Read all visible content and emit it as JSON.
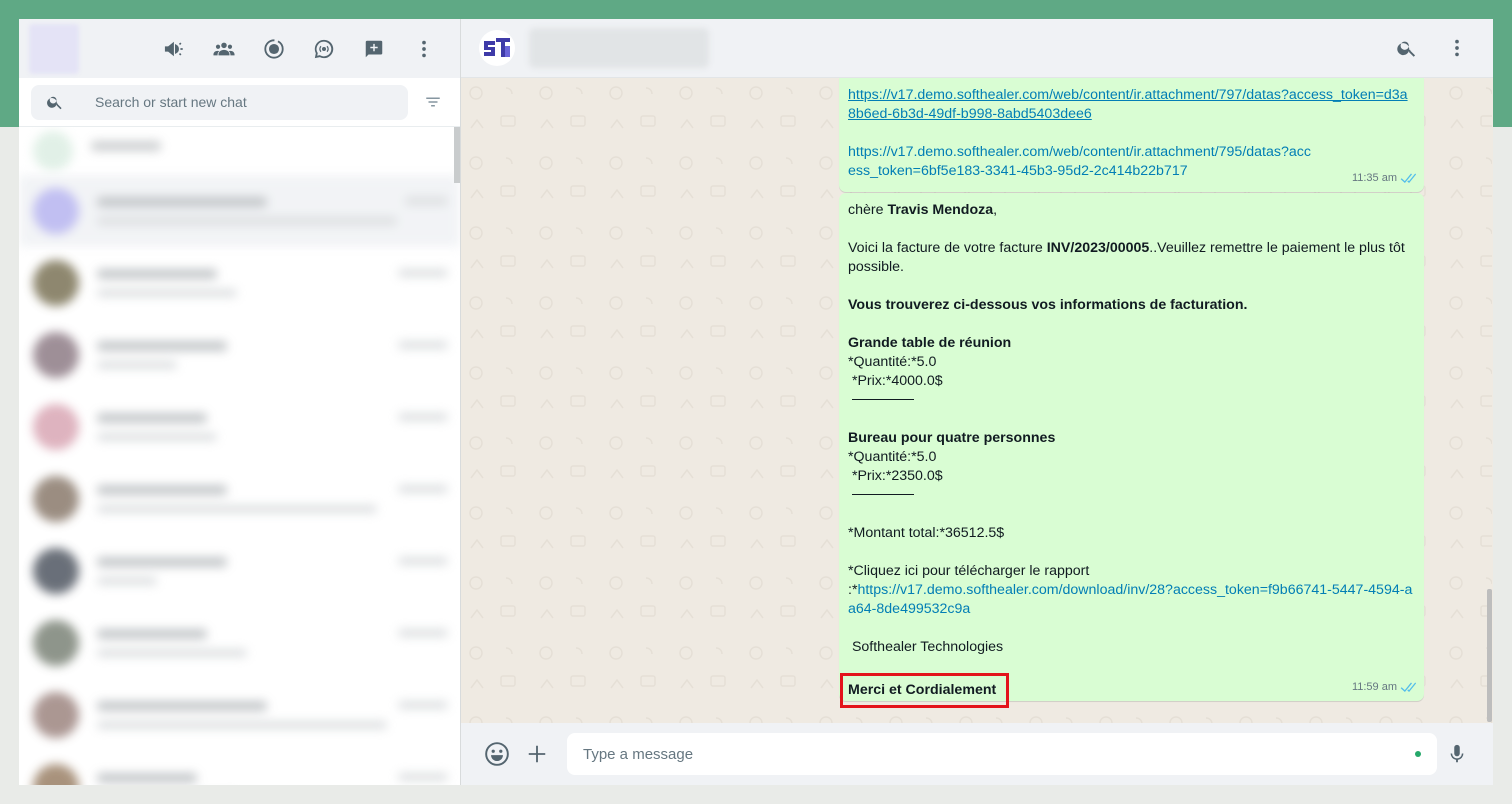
{
  "colors": {
    "accent_band": "#5fa985",
    "bubble_out": "#d9fdd3",
    "link": "#027eb5",
    "highlight_border": "#e3141b"
  },
  "left_header": {
    "icons": [
      "channels-icon",
      "communities-icon",
      "status-icon",
      "channels-chat-icon",
      "new-chat-icon",
      "menu-icon"
    ]
  },
  "search": {
    "placeholder": "Search or start new chat"
  },
  "messages": [
    {
      "links": [
        "https://v17.demo.softhealer.com/web/content/ir.attachment/797/datas?access_token=d3a8b6ed-6b3d-49df-b998-8abd5403dee6",
        "https://v17.demo.softhealer.com/web/content/ir.attachment/795/datas?access_token=6bf5e183-3341-45b3-95d2-2c414b22b717"
      ],
      "time": "11:35 am"
    },
    {
      "greeting_prefix": "chère ",
      "customer_name": "Travis Mendoza",
      "greeting_suffix": ",",
      "intro_prefix": "Voici la facture de votre facture ",
      "invoice_number": "INV/2023/00005",
      "intro_suffix": "..Veuillez remettre le paiement le plus tôt possible.",
      "billing_heading": "Vous trouverez ci-dessous vos informations de facturation.",
      "items": [
        {
          "name": "Grande table de réunion",
          "qty": "*Quantité:*5.0",
          "price": " *Prix:*4000.0$"
        },
        {
          "name": "Bureau pour quatre personnes",
          "qty": "*Quantité:*5.0",
          "price": " *Prix:*2350.0$"
        }
      ],
      "total": "*Montant total:*36512.5$",
      "download_text": "*Cliquez ici pour télécharger le rapport",
      "download_prefix": ":*",
      "download_link": "https://v17.demo.softhealer.com/download/inv/28?access_token=f9b66741-5447-4594-aa64-8de499532c9a",
      "company": " Softhealer Technologies",
      "closing": "Merci et Cordialement",
      "time": "11:59 am"
    }
  ],
  "composer": {
    "placeholder": "Type a message"
  }
}
